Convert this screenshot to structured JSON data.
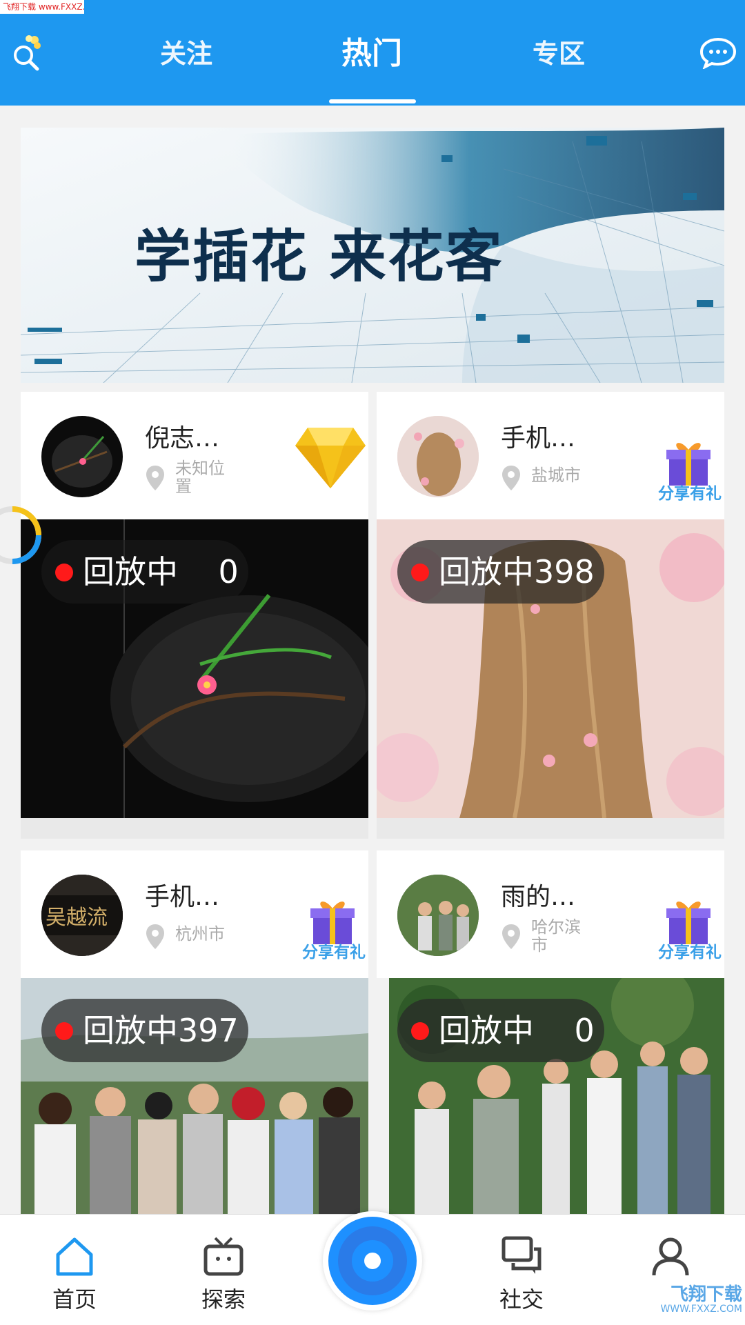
{
  "watermark_top": "飞翔下载 www.FXXZ.com",
  "header": {
    "tabs": [
      {
        "label": "关注",
        "active": false
      },
      {
        "label": "热门",
        "active": true
      },
      {
        "label": "专区",
        "active": false
      }
    ],
    "search_icon": "search-flower-icon",
    "message_icon": "message-bubble-icon",
    "color": "#1e98f0"
  },
  "banner": {
    "title": "学插花 来花客"
  },
  "cards": [
    {
      "name": "倪志…",
      "location": "未知位置",
      "badge": "diamond",
      "badge_label": "",
      "status": "回放中",
      "count": "0"
    },
    {
      "name": "手机…",
      "location": "盐城市",
      "badge": "gift",
      "badge_label": "分享有礼",
      "status": "回放中",
      "count": "398"
    },
    {
      "name": "手机…",
      "location": "杭州市",
      "badge": "gift",
      "badge_label": "分享有礼",
      "status": "回放中",
      "count": "397"
    },
    {
      "name": "雨的…",
      "location": "哈尔滨市",
      "badge": "gift",
      "badge_label": "分享有礼",
      "status": "回放中",
      "count": "0"
    }
  ],
  "bottom_nav": {
    "items": [
      {
        "label": "首页",
        "icon": "home-icon",
        "active": true
      },
      {
        "label": "探索",
        "icon": "tv-icon",
        "active": false
      },
      {
        "label": "社交",
        "icon": "chat-icon",
        "active": false
      },
      {
        "label": "",
        "icon": "user-icon",
        "active": false
      }
    ],
    "center_icon": "live-record-icon"
  },
  "watermark_bottom": {
    "line1": "飞翔下载",
    "line2": "WWW.FXXZ.COM"
  },
  "avatar_text_card3": "吴越流"
}
